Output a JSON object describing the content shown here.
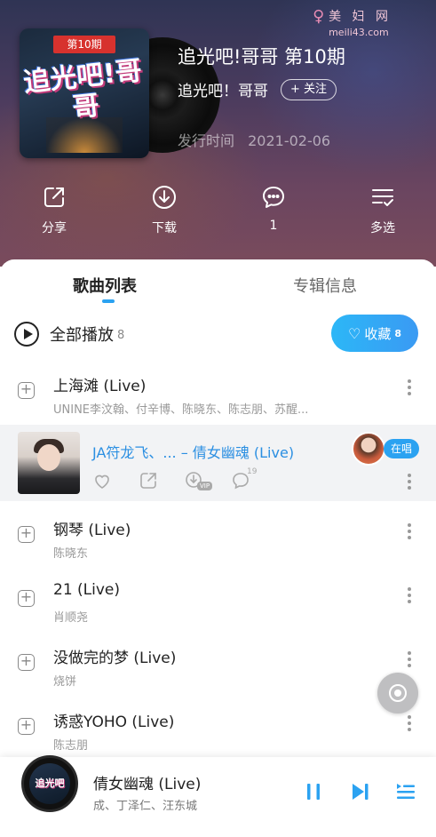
{
  "header": {
    "cover_badge": "第10期",
    "cover_title": "追光吧!哥哥",
    "album_title": "追光吧!哥哥 第10期",
    "artist": "追光吧！哥哥",
    "follow_label": "+ 关注",
    "release_label": "发行时间",
    "release_date": "2021-02-06"
  },
  "watermark": {
    "title": "美 妇 网",
    "url": "meili43.com"
  },
  "actions": [
    {
      "label": "分享",
      "icon": "share-icon"
    },
    {
      "label": "下载",
      "icon": "download-icon"
    },
    {
      "label": "1",
      "icon": "comment-icon"
    },
    {
      "label": "多选",
      "icon": "multi-select-icon"
    }
  ],
  "tabs": {
    "songs": "歌曲列表",
    "album_info": "专辑信息"
  },
  "play_all": {
    "label": "全部播放",
    "count": "8"
  },
  "collect": {
    "label": "收藏",
    "count": "8"
  },
  "songs": [
    {
      "title": "上海滩 (Live)",
      "artist": "UNINE李汶翰、付辛博、陈晓东、陈志朋、苏醒..."
    },
    {
      "title": "钢琴 (Live)",
      "artist": "陈晓东"
    },
    {
      "title": "21 (Live)",
      "artist": "肖顺尧"
    },
    {
      "title": "没做完的梦 (Live)",
      "artist": "烧饼"
    },
    {
      "title": "诱惑YOHO (Live)",
      "artist": "陈志朋"
    }
  ],
  "now_playing_row": {
    "title": "JA符龙飞、... – 倩女幽魂 (Live)",
    "singing_badge": "在唱",
    "comment_count": "19",
    "vip_label": "VIP"
  },
  "mini_player": {
    "disc_text": "追光吧",
    "title": "倩女幽魂 (Live)",
    "artist": "成、丁泽仁、汪东城"
  },
  "colors": {
    "accent": "#2ba2f1",
    "header_top": "#2f3454",
    "header_bottom": "#7a4b5c"
  }
}
